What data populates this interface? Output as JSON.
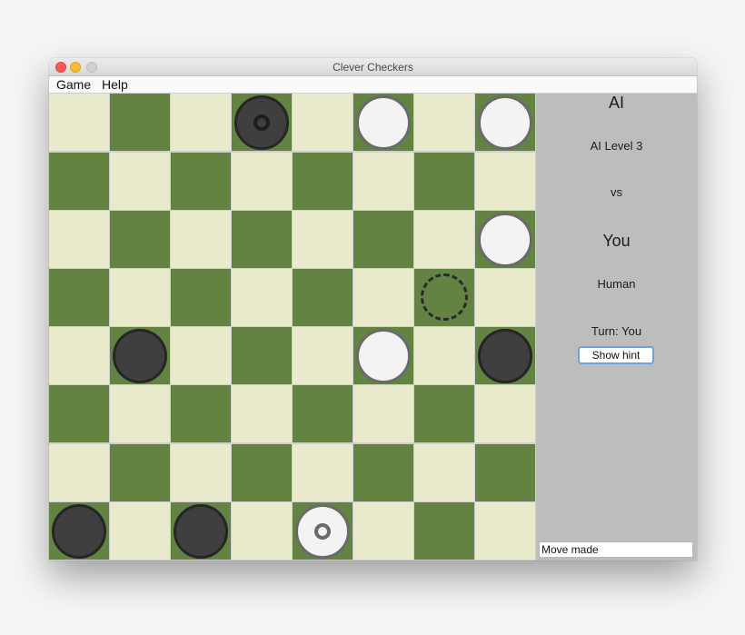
{
  "window": {
    "title": "Clever Checkers"
  },
  "menu": {
    "items": [
      "Game",
      "Help"
    ]
  },
  "board": {
    "rows": 8,
    "cols": 8,
    "pieces": [
      {
        "row": 0,
        "col": 3,
        "color": "dark",
        "king": true
      },
      {
        "row": 0,
        "col": 5,
        "color": "light",
        "king": false
      },
      {
        "row": 0,
        "col": 7,
        "color": "light",
        "king": false
      },
      {
        "row": 2,
        "col": 7,
        "color": "light",
        "king": false
      },
      {
        "row": 4,
        "col": 1,
        "color": "dark",
        "king": false
      },
      {
        "row": 4,
        "col": 5,
        "color": "light",
        "king": false
      },
      {
        "row": 4,
        "col": 7,
        "color": "dark",
        "king": false
      },
      {
        "row": 7,
        "col": 0,
        "color": "dark",
        "king": false
      },
      {
        "row": 7,
        "col": 2,
        "color": "dark",
        "king": false
      },
      {
        "row": 7,
        "col": 4,
        "color": "light",
        "king": true
      }
    ],
    "hints": [
      {
        "row": 3,
        "col": 6
      }
    ],
    "colors": {
      "light_square": "#e9e9cb",
      "dark_square": "#628342"
    }
  },
  "sidebar": {
    "player1_name": "AI",
    "player1_type": "AI Level 3",
    "vs": "vs",
    "player2_name": "You",
    "player2_type": "Human",
    "turn": "Turn: You",
    "hint_button": "Show hint",
    "status": "Move made"
  }
}
